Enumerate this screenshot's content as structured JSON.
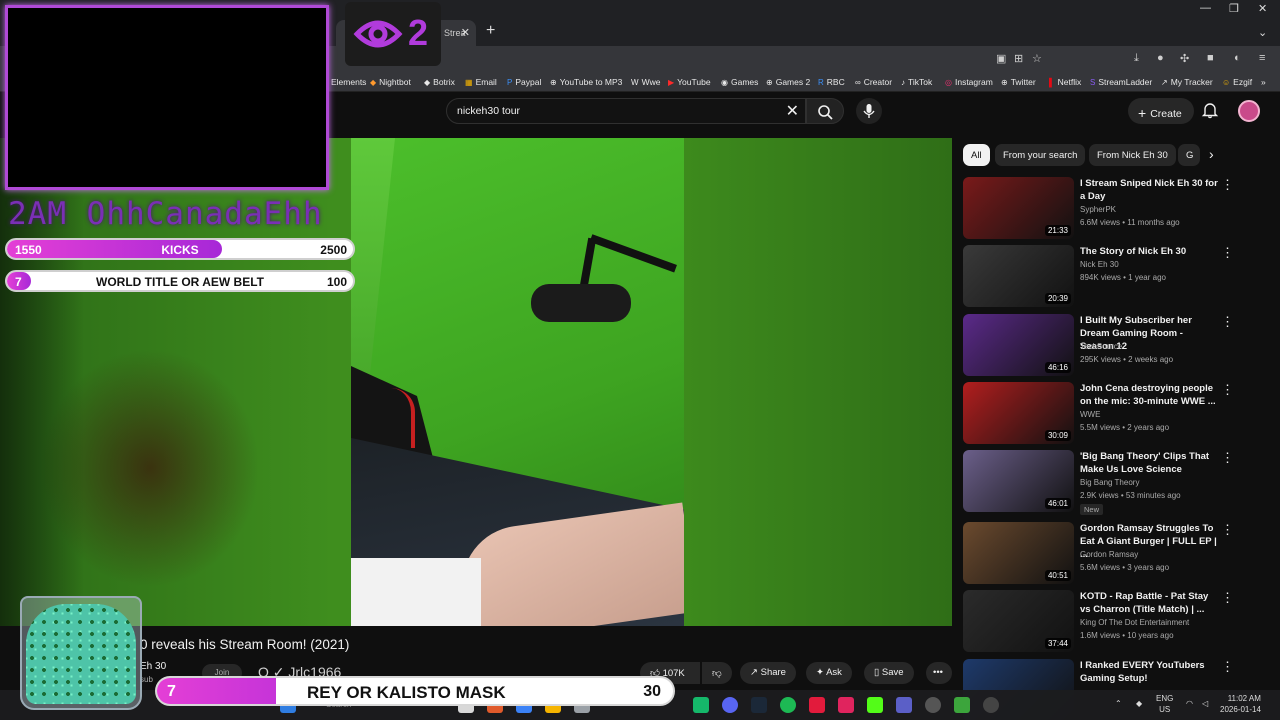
{
  "browser": {
    "tab_title": "Strea",
    "bookmarks": [
      "Elements",
      "Nightbot",
      "Botrix",
      "Email",
      "Paypal",
      "YouTube to MP3",
      "Wwe",
      "YouTube",
      "Games",
      "Games 2",
      "RBC",
      "Creator",
      "TikTok",
      "Instagram",
      "Twitter",
      "Netflix",
      "StreamLadder",
      "My Tracker",
      "Ezgif"
    ]
  },
  "youtube": {
    "search_value": "nickeh30 tour",
    "create_label": "Create",
    "video_title": "0 reveals his Stream Room! (2021)",
    "channel_name": "Eh 30",
    "subscribers": "sub",
    "join_label": "Join",
    "likes": "107K",
    "share_label": "Share",
    "ask_label": "Ask",
    "save_label": "Save",
    "chips": [
      "All",
      "From your search",
      "From Nick Eh 30",
      "G"
    ],
    "recommendations": [
      {
        "title": "I Stream Sniped Nick Eh 30 for a Day",
        "channel": "SypherPK",
        "meta": "6.6M views • 11 months ago",
        "duration": "21:33",
        "thumb_color": "#7a1a1a"
      },
      {
        "title": "The Story of Nick Eh 30",
        "channel": "Nick Eh 30",
        "meta": "894K views • 1 year ago",
        "duration": "20:39",
        "thumb_color": "#3a3a3a"
      },
      {
        "title": "I Built My Subscriber her Dream Gaming Room - Season 12",
        "channel": "TechSource",
        "meta": "295K views • 2 weeks ago",
        "duration": "46:16",
        "thumb_color": "#5b2a8a"
      },
      {
        "title": "John Cena destroying people on the mic: 30-minute WWE ...",
        "channel": "WWE",
        "meta": "5.5M views • 2 years ago",
        "duration": "30:09",
        "thumb_color": "#b21e1e"
      },
      {
        "title": "'Big Bang Theory' Clips That Make Us Love Science",
        "channel": "Big Bang Theory",
        "meta": "2.9K views • 53 minutes ago",
        "duration": "46:01",
        "thumb_color": "#6b5f8a",
        "badge": "New"
      },
      {
        "title": "Gordon Ramsay Struggles To Eat A Giant Burger | FULL EP | ...",
        "channel": "Gordon Ramsay",
        "meta": "5.6M views • 3 years ago",
        "duration": "40:51",
        "thumb_color": "#6b4a2e"
      },
      {
        "title": "KOTD - Rap Battle - Pat Stay vs Charron (Title Match) | ...",
        "channel": "King Of The Dot Entertainment",
        "meta": "1.6M views • 10 years ago",
        "duration": "37:44",
        "thumb_color": "#2b2b2b"
      },
      {
        "title": "I Ranked EVERY YouTubers Gaming Setup!",
        "channel": "",
        "meta": "",
        "duration": "",
        "thumb_color": "#1e3a6b"
      }
    ]
  },
  "overlay": {
    "viewer_count": "2",
    "streamer_handle": "2AM OhhCanadaEhh",
    "goals": [
      {
        "left": "1550",
        "label": "KICKS",
        "right": "2500",
        "progress": 0.62
      },
      {
        "left": "7",
        "label": "WORLD TITLE OR AEW BELT",
        "right": "100",
        "progress": 0.07
      }
    ],
    "bottom_goal": {
      "left": "7",
      "label": "REY OR KALISTO MASK",
      "right": "30",
      "progress": 0.23
    },
    "chat_user": "Q ✓ Jrlc1966",
    "colors": {
      "accent": "#b13bdc",
      "bar_fill": "#e43fd6",
      "green_screen": "#3f8e1e"
    }
  },
  "taskbar": {
    "search_placeholder": "Search",
    "lang": "ENG",
    "region": "US",
    "time": "11:02 AM",
    "date": "2026-01-14"
  }
}
